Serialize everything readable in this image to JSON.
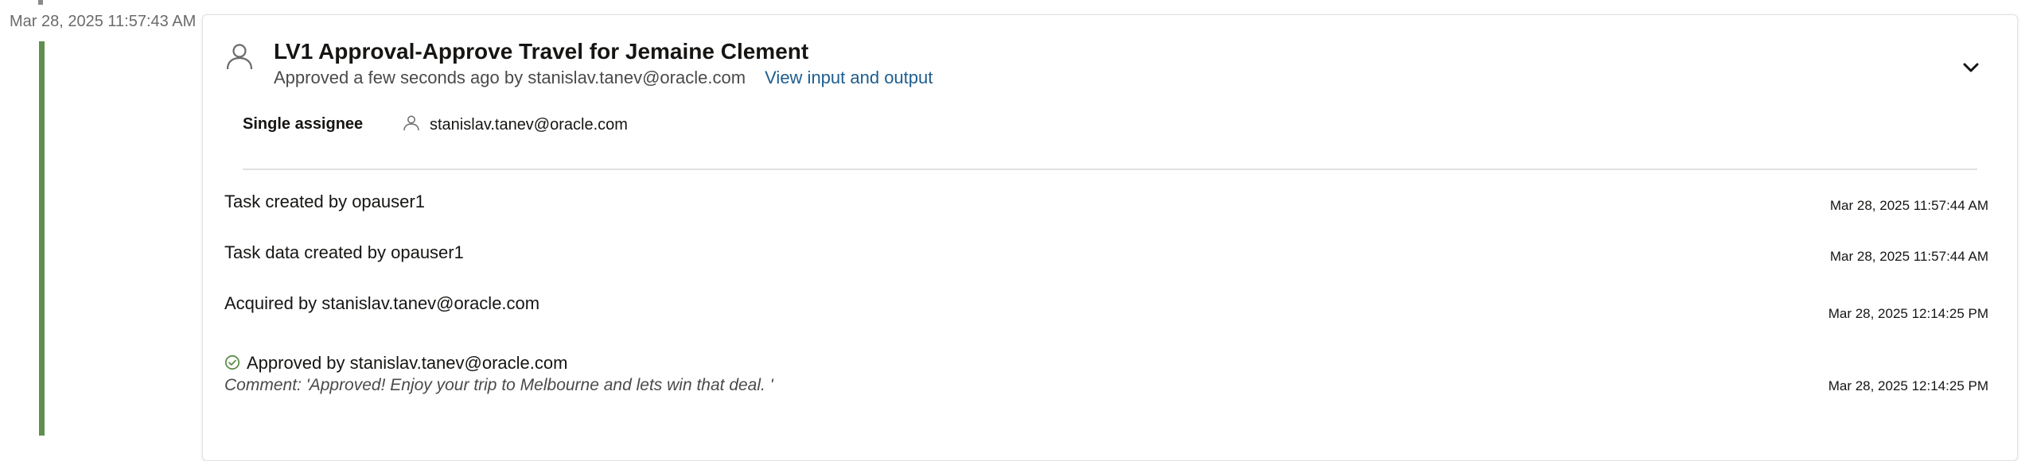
{
  "timeline": {
    "timestamp": "Mar 28, 2025 11:57:43 AM",
    "accent_color": "#5f8f4d"
  },
  "task": {
    "title": "LV1 Approval-Approve Travel for Jemaine Clement",
    "subtitle": "Approved a few seconds ago by stanislav.tanev@oracle.com",
    "view_io_link": "View input and output",
    "icon": "person-icon",
    "toggle_icon": "chevron-down-icon"
  },
  "assignee": {
    "label": "Single assignee",
    "icon": "person-icon",
    "value": "stanislav.tanev@oracle.com"
  },
  "events": [
    {
      "text": "Task created by opauser1",
      "time": "Mar 28, 2025 11:57:44 AM"
    },
    {
      "text": "Task data created by opauser1",
      "time": "Mar 28, 2025 11:57:44 AM"
    },
    {
      "text": "Acquired by stanislav.tanev@oracle.com",
      "time": "Mar 28, 2025 12:14:25 PM"
    },
    {
      "icon": "check-circle-icon",
      "text": "Approved by stanislav.tanev@oracle.com",
      "comment": "Comment: 'Approved! Enjoy your trip to Melbourne and lets win that deal. '",
      "time": "Mar 28, 2025 12:14:25 PM"
    }
  ],
  "colors": {
    "link": "#1d5d8f",
    "success": "#5f8f4d"
  }
}
